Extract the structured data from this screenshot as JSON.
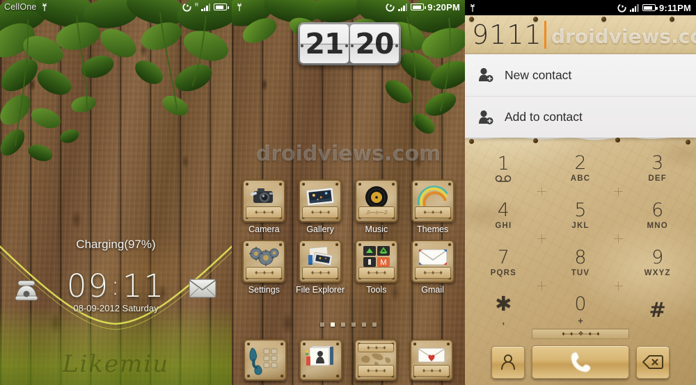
{
  "panels": {
    "lockscreen": {
      "name": "Lock screen",
      "statusbar": {
        "carrier": "CellOne",
        "usb_icon": "usb-icon",
        "sync_icon": "sync-icon",
        "signal_icon": "signal-bars-icon",
        "signal_roaming": "R",
        "battery_icon": "battery-icon"
      },
      "charging_text": "Charging(97%)",
      "clock_hours": "09",
      "clock_separator": ":",
      "clock_minutes": "11",
      "date": "08-09-2012 Saturday",
      "left_shortcut_icon": "telephone-icon",
      "right_shortcut_icon": "envelope-icon",
      "signature_text": "Likemiu"
    },
    "homescreen": {
      "name": "Home screen",
      "statusbar": {
        "usb_icon": "usb-icon",
        "sync_icon": "sync-icon",
        "signal_icon": "signal-bars-icon",
        "battery_icon": "battery-icon",
        "time": "9:20PM"
      },
      "clock_widget": {
        "hours": "21",
        "minutes": "20"
      },
      "watermark": "droidviews.com",
      "apps_row1": [
        {
          "label": "Camera",
          "icon": "camera-icon"
        },
        {
          "label": "Gallery",
          "icon": "photos-icon"
        },
        {
          "label": "Music",
          "icon": "vinyl-record-icon"
        },
        {
          "label": "Themes",
          "icon": "rainbow-icon"
        }
      ],
      "apps_row2": [
        {
          "label": "Settings",
          "icon": "gears-icon"
        },
        {
          "label": "File Explorer",
          "icon": "folder-documents-icon"
        },
        {
          "label": "Tools",
          "icon": "folder-group-icon"
        },
        {
          "label": "Gmail",
          "icon": "envelope-icon"
        }
      ],
      "page_dots": {
        "count": 6,
        "active_index": 1
      },
      "dock": [
        {
          "label": "Phone",
          "icon": "dialer-handset-icon"
        },
        {
          "label": "Contacts",
          "icon": "contacts-photos-icon"
        },
        {
          "label": "Browser",
          "icon": "world-map-icon"
        },
        {
          "label": "Messaging",
          "icon": "envelope-heart-icon"
        }
      ]
    },
    "dialer": {
      "name": "Dialer",
      "statusbar": {
        "usb_icon": "usb-icon",
        "sync_icon": "sync-icon",
        "signal_icon": "signal-bars-icon",
        "battery_icon": "battery-icon",
        "time": "9:11PM"
      },
      "entered_number": "9111",
      "watermark": "droidviews.com",
      "suggestions": [
        {
          "label": "New contact",
          "icon": "person-add-icon"
        },
        {
          "label": "Add to contact",
          "icon": "person-add-icon"
        }
      ],
      "keypad": [
        [
          {
            "digit": "1",
            "sub": "",
            "sub_icon": "voicemail-icon"
          },
          {
            "digit": "2",
            "sub": "ABC"
          },
          {
            "digit": "3",
            "sub": "DEF"
          }
        ],
        [
          {
            "digit": "4",
            "sub": "GHI"
          },
          {
            "digit": "5",
            "sub": "JKL"
          },
          {
            "digit": "6",
            "sub": "MNO"
          }
        ],
        [
          {
            "digit": "7",
            "sub": "PQRS"
          },
          {
            "digit": "8",
            "sub": "TUV"
          },
          {
            "digit": "9",
            "sub": "WXYZ"
          }
        ],
        [
          {
            "digit": "✱",
            "sub": ","
          },
          {
            "digit": "0",
            "sub": "+"
          },
          {
            "digit": "#",
            "sub": ""
          }
        ]
      ],
      "actions": [
        {
          "name": "contacts-button",
          "icon": "person-icon"
        },
        {
          "name": "call-button",
          "icon": "phone-handset-icon"
        },
        {
          "name": "backspace-button",
          "icon": "backspace-icon"
        }
      ]
    }
  },
  "colors": {
    "cursor": "#f08a20",
    "wood_dark": "#6b4a2e",
    "wood_light": "#8b6743",
    "paper": "#dcc89c",
    "gold_button": "#d8b775",
    "statusbar_bg": "#000000",
    "grass_green": "#82aa19"
  }
}
